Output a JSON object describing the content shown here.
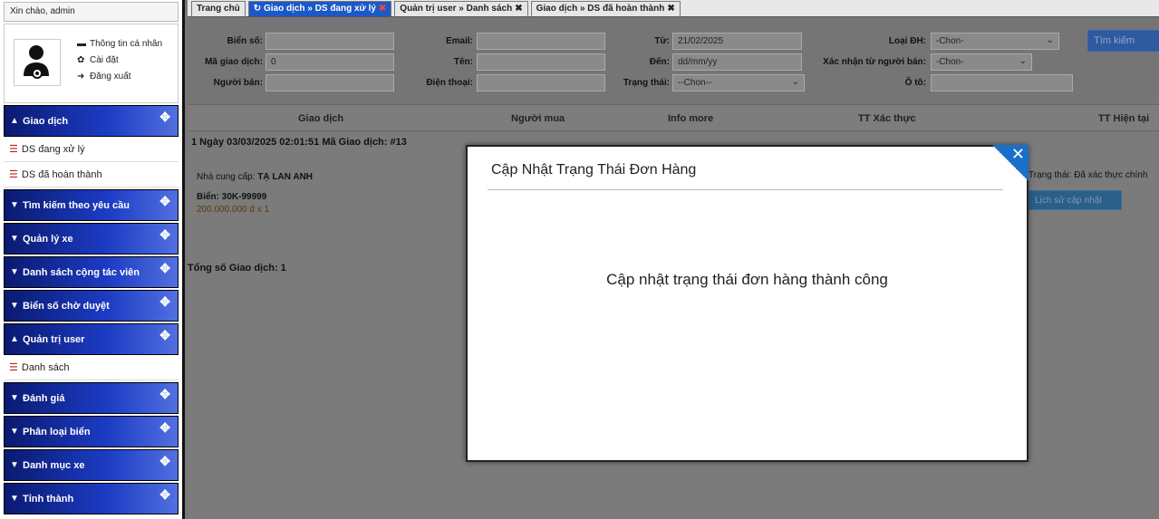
{
  "sidebar": {
    "greeting": "Xin chào, admin",
    "profile_links": [
      {
        "icon": "comment-icon",
        "label": "Thông tin cá nhân"
      },
      {
        "icon": "gear-icon",
        "label": "Cài đặt"
      },
      {
        "icon": "logout-icon",
        "label": "Đăng xuất"
      }
    ],
    "sections": [
      {
        "label": "Giao dịch",
        "expanded": true
      },
      {
        "label": "Tìm kiếm theo yêu cầu",
        "expanded": false
      },
      {
        "label": "Quản lý xe",
        "expanded": false
      },
      {
        "label": "Danh sách cộng tác viên",
        "expanded": false
      },
      {
        "label": "Biển số chờ duyệt",
        "expanded": false
      },
      {
        "label": "Quản trị user",
        "expanded": true
      },
      {
        "label": "Đánh giá",
        "expanded": false
      },
      {
        "label": "Phân loại biển",
        "expanded": false
      },
      {
        "label": "Danh mục xe",
        "expanded": false
      },
      {
        "label": "Tỉnh thành",
        "expanded": false
      }
    ],
    "giao_dich_items": [
      "DS đang xử lý",
      "DS đã hoàn thành"
    ],
    "quan_tri_items": [
      "Danh sách"
    ]
  },
  "tabs": [
    {
      "label": "Trang chủ",
      "active": false
    },
    {
      "label": "Giao dịch » DS đang xử lý",
      "active": true
    },
    {
      "label": "Quản trị user » Danh sách",
      "active": false
    },
    {
      "label": "Giao dịch » DS đã hoàn thành",
      "active": false
    }
  ],
  "tab_close": "✖",
  "filters": {
    "bien_so": {
      "label": "Biển số:",
      "value": ""
    },
    "ma_gd": {
      "label": "Mã giao dịch:",
      "value": "0"
    },
    "nguoi_ban": {
      "label": "Người bán:",
      "value": ""
    },
    "email": {
      "label": "Email:",
      "value": ""
    },
    "ten": {
      "label": "Tên:",
      "value": ""
    },
    "dien_thoai": {
      "label": "Điện thoại:",
      "value": ""
    },
    "tu": {
      "label": "Từ:",
      "value": "21/02/2025"
    },
    "den": {
      "label": "Đến:",
      "value": "dd/mm/yy"
    },
    "trang_thai": {
      "label": "Trạng thái:",
      "value": "--Chon--"
    },
    "loai_dh": {
      "label": "Loại ĐH:",
      "value": "-Chon-"
    },
    "xac_nhan": {
      "label": "Xác nhận từ người bán:",
      "value": "-Chon-"
    },
    "oto": {
      "label": "Ô tô:",
      "value": ""
    },
    "search_button": "Tìm kiếm"
  },
  "table": {
    "headers": [
      "Giao dịch",
      "Người mua",
      "Info more",
      "TT Xác thực",
      "TT Hiện tại"
    ],
    "row_header": "1   Ngày 03/03/2025 02:01:51   Mã Giao dịch: #13",
    "supplier_label": "Nhà cung cấp:",
    "supplier_name": "TẠ LAN ANH",
    "plate": "Biển: 30K-99999",
    "price": "200.000.000 đ x 1",
    "status_now": "Trạng thái: Đã xác thực chính",
    "history_button": "Lịch sử cập nhật",
    "total": "Tổng số Giao dịch:  1"
  },
  "modal": {
    "title": "Cập Nhật Trạng Thái Đơn Hàng",
    "message": "Cập nhật trạng thái đơn hàng thành công",
    "close": "✕"
  }
}
